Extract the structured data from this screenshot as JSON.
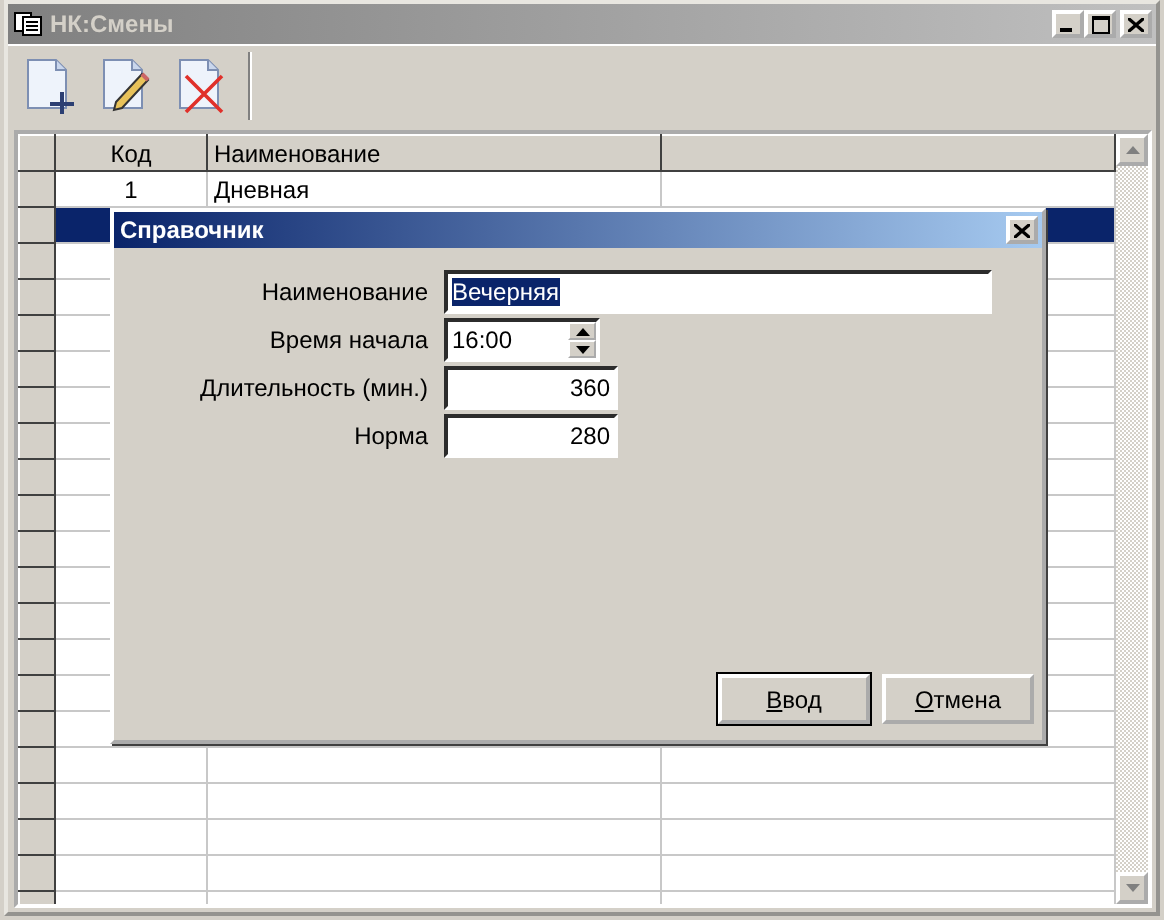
{
  "window": {
    "title": "НК:Смены",
    "controls": [
      {
        "kind": "minimize"
      },
      {
        "kind": "maximize"
      },
      {
        "kind": "close"
      }
    ]
  },
  "toolbar": [
    {
      "kind": "new"
    },
    {
      "kind": "edit"
    },
    {
      "kind": "delete"
    }
  ],
  "table": {
    "columns": [
      "Код",
      "Наименование"
    ],
    "rows": [
      {
        "code": "1",
        "name": "Дневная",
        "selected": false
      },
      {
        "code": "",
        "name": "",
        "selected": true
      }
    ]
  },
  "dialog": {
    "title": "Справочник",
    "fields": [
      {
        "kind": "text",
        "label": "Наименование",
        "value": "Вечерняя"
      },
      {
        "kind": "spin",
        "label": "Время начала",
        "value": "16:00"
      },
      {
        "kind": "number",
        "label": "Длительность (мин.)",
        "value": "360"
      },
      {
        "kind": "number",
        "label": "Норма",
        "value": "280"
      }
    ],
    "buttons": [
      {
        "label": "Ввод",
        "default": true
      },
      {
        "label": "Отмена",
        "default": false
      }
    ]
  }
}
